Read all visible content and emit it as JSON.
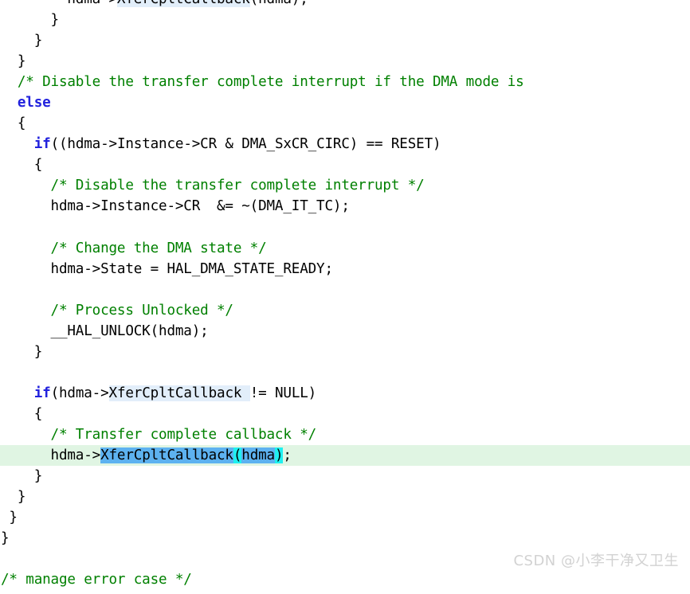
{
  "editor": {
    "language": "c",
    "background_color": "#ffffff",
    "text_color": "#000000",
    "comment_color": "#008000",
    "keyword_color": "#2222dd",
    "current_line_color": "#e0f5e3",
    "occurrence_highlight_color": "#e2eefa",
    "selection_color": "#5db2f0",
    "bracket_match_color": "#1ff0f0",
    "font_size_px": 17.6,
    "line_height_px": 26
  },
  "code": {
    "lines": [
      {
        "id": "line-1",
        "current": false,
        "tokens": [
          {
            "text": "        hdma->",
            "style": "plain"
          },
          {
            "text": "XferCpltCallback",
            "style": "occurrence"
          },
          {
            "text": "(hdma);",
            "style": "plain"
          }
        ]
      },
      {
        "id": "line-2",
        "current": false,
        "tokens": [
          {
            "text": "      }",
            "style": "plain"
          }
        ]
      },
      {
        "id": "line-3",
        "current": false,
        "tokens": [
          {
            "text": "    }",
            "style": "plain"
          }
        ]
      },
      {
        "id": "line-4",
        "current": false,
        "tokens": [
          {
            "text": "  }",
            "style": "plain"
          }
        ]
      },
      {
        "id": "line-5",
        "current": false,
        "tokens": [
          {
            "text": "  /* Disable the transfer complete interrupt if the DMA mode is",
            "style": "comment"
          }
        ]
      },
      {
        "id": "line-6",
        "current": false,
        "tokens": [
          {
            "text": "  ",
            "style": "plain"
          },
          {
            "text": "else",
            "style": "keyword"
          }
        ]
      },
      {
        "id": "line-7",
        "current": false,
        "tokens": [
          {
            "text": "  {",
            "style": "plain"
          }
        ]
      },
      {
        "id": "line-8",
        "current": false,
        "tokens": [
          {
            "text": "    ",
            "style": "plain"
          },
          {
            "text": "if",
            "style": "keyword"
          },
          {
            "text": "((hdma->Instance->CR & DMA_SxCR_CIRC) == RESET)",
            "style": "plain"
          }
        ]
      },
      {
        "id": "line-9",
        "current": false,
        "tokens": [
          {
            "text": "    {",
            "style": "plain"
          }
        ]
      },
      {
        "id": "line-10",
        "current": false,
        "tokens": [
          {
            "text": "      /* Disable the transfer complete interrupt */",
            "style": "comment"
          }
        ]
      },
      {
        "id": "line-11",
        "current": false,
        "tokens": [
          {
            "text": "      hdma->Instance->CR  &= ~(DMA_IT_TC);",
            "style": "plain"
          }
        ]
      },
      {
        "id": "line-12",
        "current": false,
        "tokens": []
      },
      {
        "id": "line-13",
        "current": false,
        "tokens": [
          {
            "text": "      /* Change the DMA state */",
            "style": "comment"
          }
        ]
      },
      {
        "id": "line-14",
        "current": false,
        "tokens": [
          {
            "text": "      hdma->State = HAL_DMA_STATE_READY;",
            "style": "plain"
          }
        ]
      },
      {
        "id": "line-15",
        "current": false,
        "tokens": []
      },
      {
        "id": "line-16",
        "current": false,
        "tokens": [
          {
            "text": "      /* Process Unlocked */",
            "style": "comment"
          }
        ]
      },
      {
        "id": "line-17",
        "current": false,
        "tokens": [
          {
            "text": "      __HAL_UNLOCK(hdma);",
            "style": "plain"
          }
        ]
      },
      {
        "id": "line-18",
        "current": false,
        "tokens": [
          {
            "text": "    }",
            "style": "plain"
          }
        ]
      },
      {
        "id": "line-19",
        "current": false,
        "tokens": []
      },
      {
        "id": "line-20",
        "current": false,
        "tokens": [
          {
            "text": "    ",
            "style": "plain"
          },
          {
            "text": "if",
            "style": "keyword"
          },
          {
            "text": "(hdma->",
            "style": "plain"
          },
          {
            "text": "XferCpltCallback ",
            "style": "occurrence"
          },
          {
            "text": "!= NULL)",
            "style": "plain"
          }
        ]
      },
      {
        "id": "line-21",
        "current": false,
        "tokens": [
          {
            "text": "    {",
            "style": "plain"
          }
        ]
      },
      {
        "id": "line-22",
        "current": false,
        "tokens": [
          {
            "text": "      /* Transfer complete callback */",
            "style": "comment"
          }
        ]
      },
      {
        "id": "line-23",
        "current": true,
        "tokens": [
          {
            "text": "      hdma->",
            "style": "plain"
          },
          {
            "text": "XferCpltCallback",
            "style": "selection"
          },
          {
            "text": "(",
            "style": "bracket"
          },
          {
            "text": "hdma",
            "style": "selection"
          },
          {
            "text": ")",
            "style": "bracket"
          },
          {
            "text": ";",
            "style": "plain"
          }
        ]
      },
      {
        "id": "line-24",
        "current": false,
        "tokens": [
          {
            "text": "    }",
            "style": "plain"
          }
        ]
      },
      {
        "id": "line-25",
        "current": false,
        "tokens": [
          {
            "text": "  }",
            "style": "plain"
          }
        ]
      },
      {
        "id": "line-26",
        "current": false,
        "tokens": [
          {
            "text": " }",
            "style": "plain"
          }
        ]
      },
      {
        "id": "line-27",
        "current": false,
        "tokens": [
          {
            "text": "}",
            "style": "plain"
          }
        ]
      },
      {
        "id": "line-28",
        "current": false,
        "tokens": []
      },
      {
        "id": "line-29",
        "current": false,
        "tokens": [
          {
            "text": "/* manage error case */",
            "style": "comment"
          }
        ]
      }
    ]
  },
  "watermark": {
    "text": "CSDN @小李干净又卫生"
  }
}
